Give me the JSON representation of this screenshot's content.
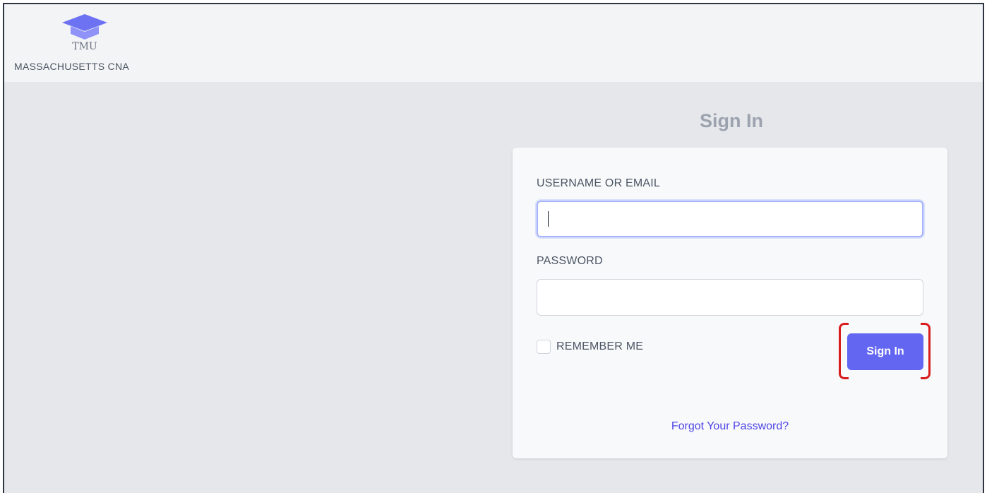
{
  "header": {
    "logo_text": "TMU",
    "brand_name": "MASSACHUSETTS CNA",
    "logo_icon": "graduation-cap-icon"
  },
  "login": {
    "title": "Sign In",
    "username_label": "USERNAME OR EMAIL",
    "username_value": "",
    "password_label": "PASSWORD",
    "password_value": "",
    "remember_label": "REMEMBER ME",
    "remember_checked": false,
    "submit_label": "Sign In",
    "forgot_label": "Forgot Your Password?"
  },
  "colors": {
    "accent": "#6366f1",
    "link": "#4f46e5",
    "highlight": "#d91c1c",
    "page_background": "#e5e7eb"
  }
}
